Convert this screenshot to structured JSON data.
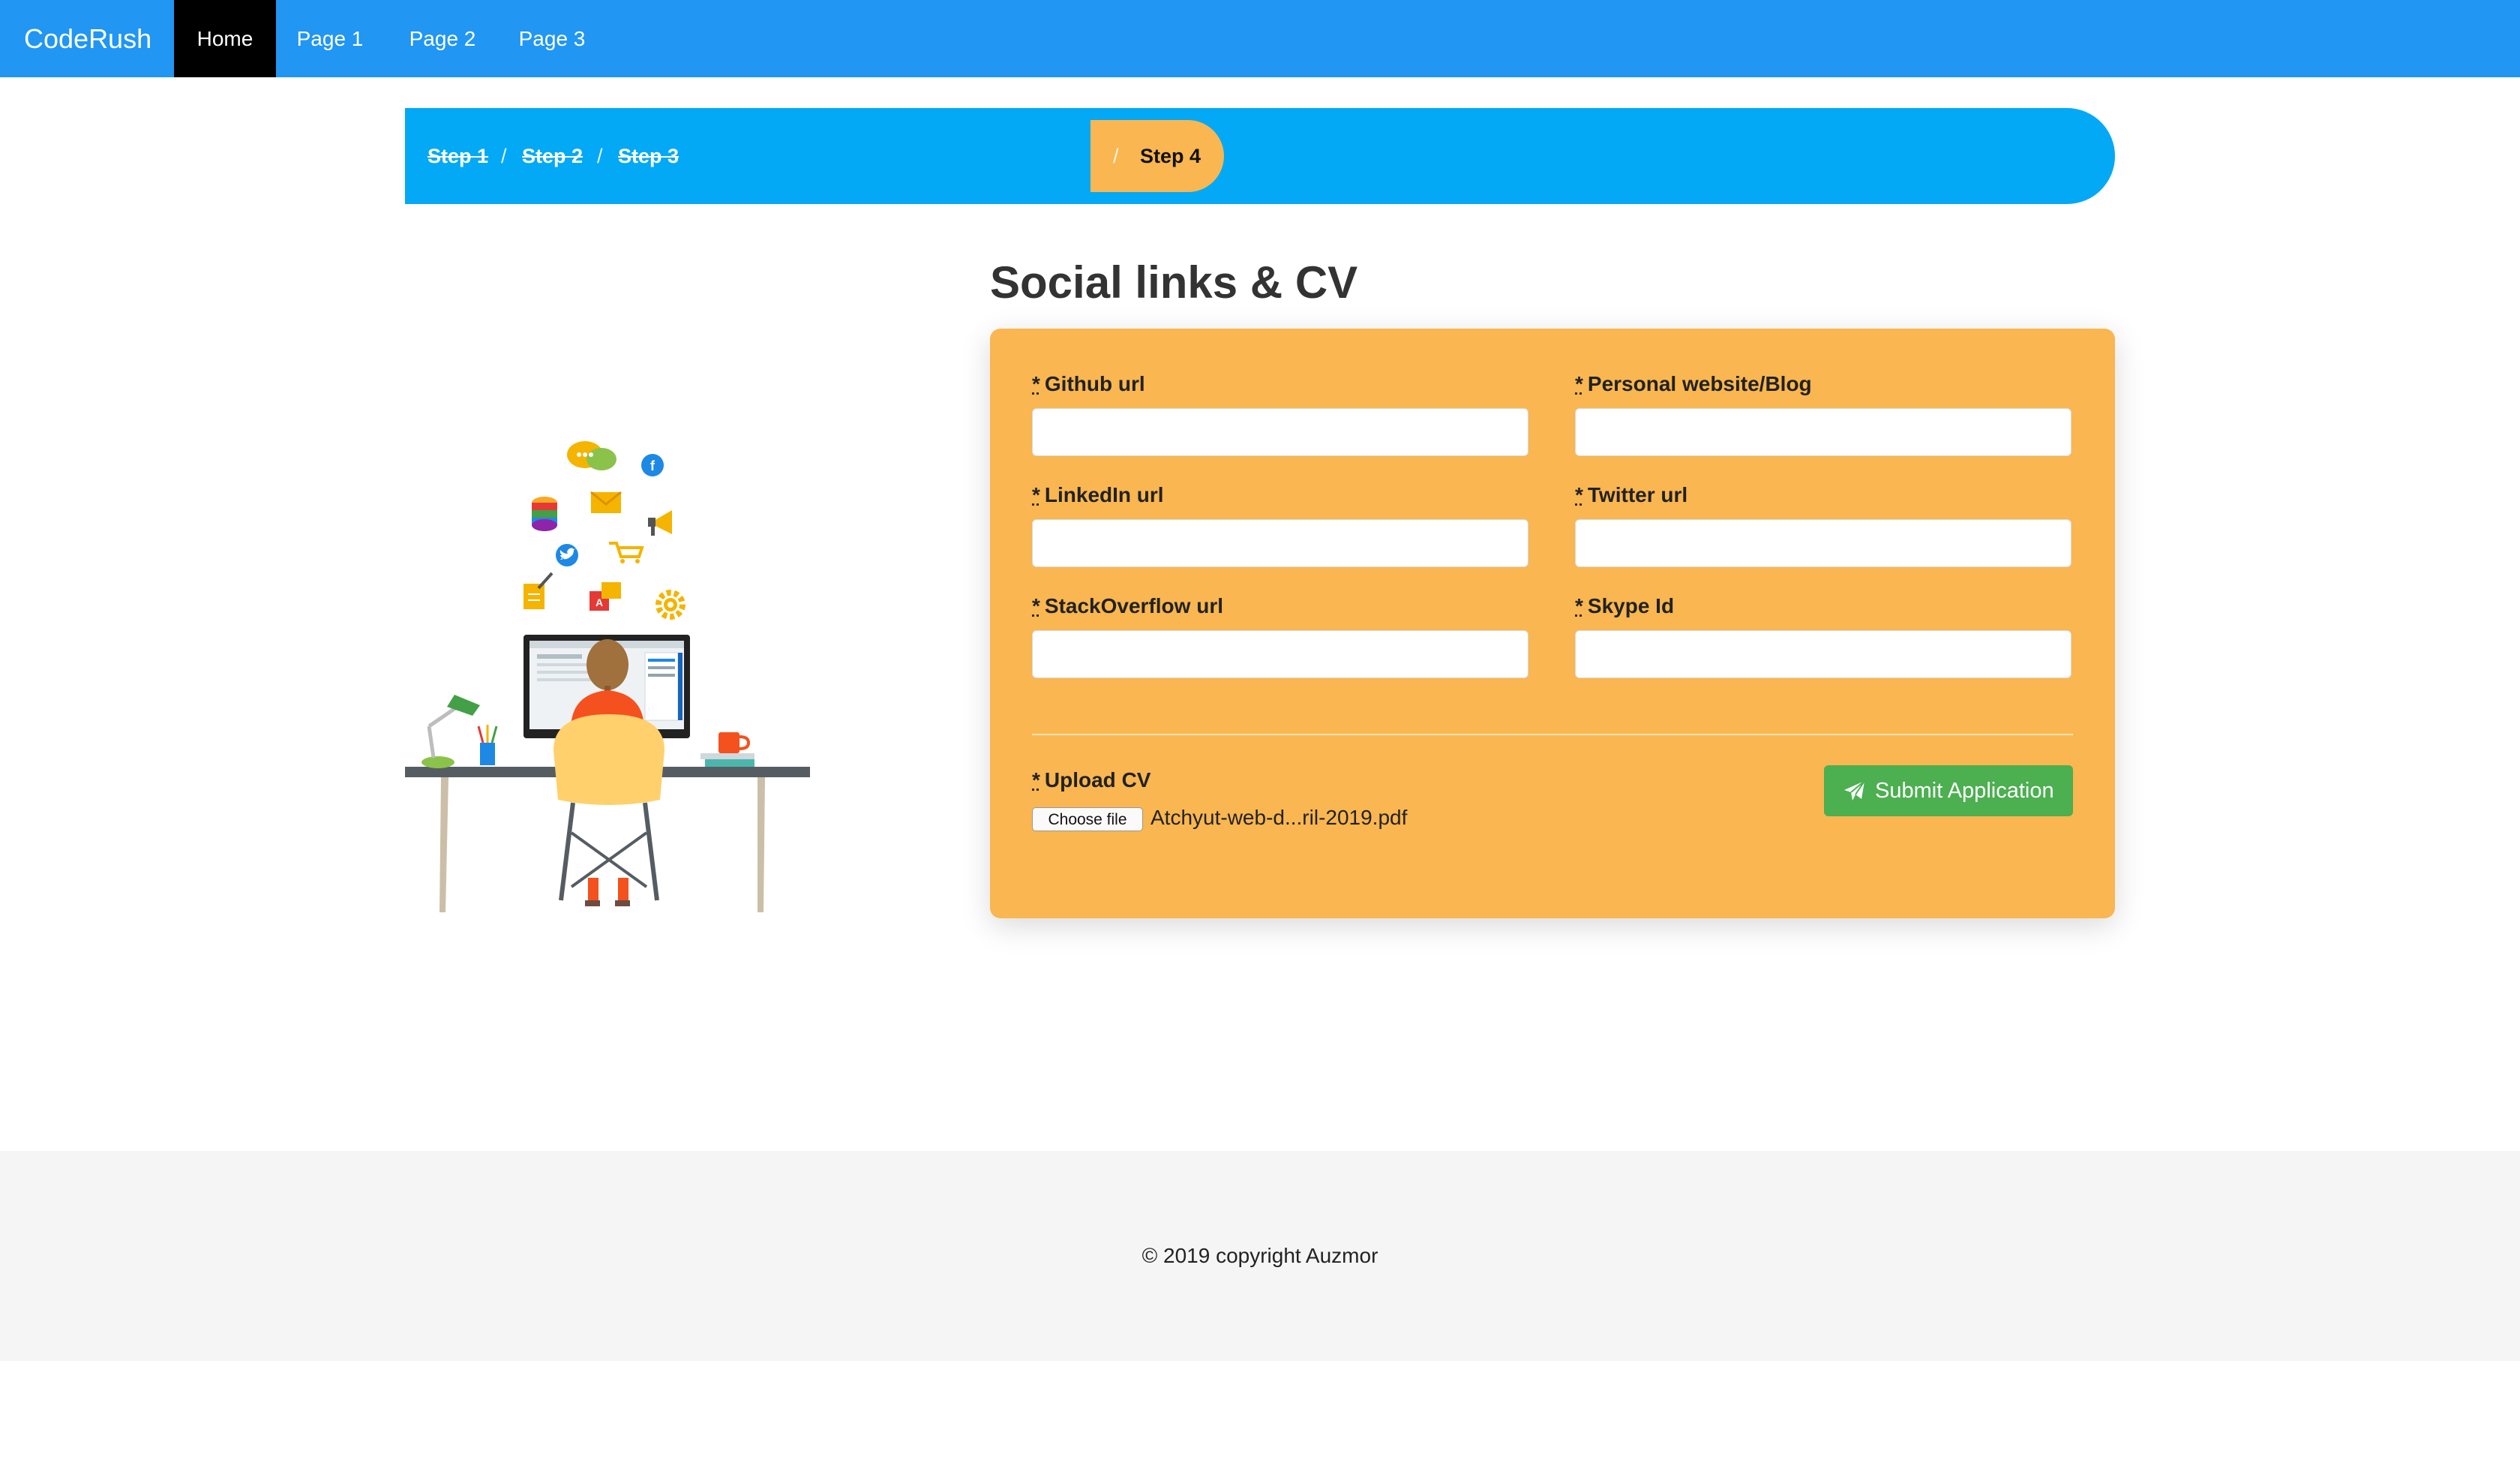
{
  "navbar": {
    "brand": "CodeRush",
    "items": [
      "Home",
      "Page 1",
      "Page 2",
      "Page 3"
    ],
    "active": "Home"
  },
  "breadcrumb": {
    "steps": [
      "Step 1",
      "Step 2",
      "Step 3",
      "Step 4"
    ],
    "separator": "/",
    "current": "Step 4"
  },
  "form": {
    "title": "Social links & CV",
    "required_marker": "*",
    "fields": {
      "github": {
        "label": "Github url",
        "value": ""
      },
      "website": {
        "label": "Personal website/Blog",
        "value": ""
      },
      "linkedin": {
        "label": "LinkedIn url",
        "value": ""
      },
      "twitter": {
        "label": "Twitter url",
        "value": ""
      },
      "stackoverflow": {
        "label": "StackOverflow url",
        "value": ""
      },
      "skype": {
        "label": "Skype Id",
        "value": ""
      }
    },
    "upload": {
      "label": "Upload CV",
      "button": "Choose file",
      "filename": "Atchyut-web-d...ril-2019.pdf"
    },
    "submit_label": "Submit Application"
  },
  "colors": {
    "navbar": "#2196f3",
    "breadcrumb": "#03a9f4",
    "accent": "#f9b651",
    "submit": "#4caf50",
    "active_nav": "#000000"
  },
  "footer": {
    "copyright": "© 2019 copyright Auzmor"
  }
}
